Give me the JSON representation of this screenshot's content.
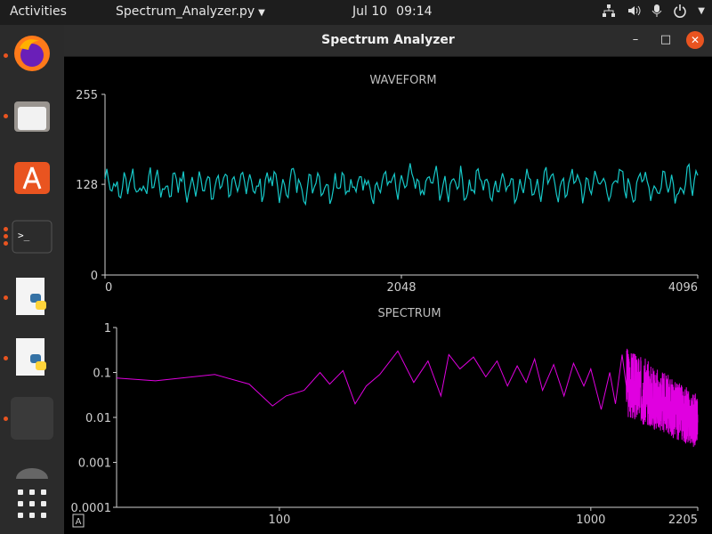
{
  "topbar": {
    "activities": "Activities",
    "app_menu": "Spectrum_Analyzer.py",
    "date": "Jul 10",
    "time": "09:14"
  },
  "dock": {
    "items": [
      "firefox-icon",
      "files-icon",
      "app-center-icon",
      "terminal-icon",
      "python-file-icon",
      "python-file-icon",
      "trash-icon",
      "show-apps-icon"
    ]
  },
  "window": {
    "title": "Spectrum Analyzer",
    "controls": {
      "minimize": "–",
      "maximize": "□",
      "close": "✕"
    },
    "corner_badge": "A"
  },
  "colors": {
    "waveform": "#16c8c8",
    "spectrum": "#e000e0",
    "accent": "#e95420"
  },
  "chart_data": [
    {
      "type": "line",
      "title": "WAVEFORM",
      "xlabel": "",
      "ylabel": "",
      "xlim": [
        0,
        4096
      ],
      "ylim": [
        0,
        255
      ],
      "x_ticks": [
        "0",
        "2048",
        "4096"
      ],
      "y_ticks": [
        "0",
        "128",
        "255"
      ],
      "series": [
        {
          "x": [
            0,
            4096
          ],
          "baseline": 128,
          "amplitude_range": [
            100,
            160
          ]
        }
      ]
    },
    {
      "type": "line",
      "title": "SPECTRUM",
      "xlabel": "",
      "ylabel": "",
      "x_scale": "log",
      "y_scale": "log",
      "xlim": [
        30,
        2205
      ],
      "ylim": [
        0.0001,
        1
      ],
      "x_ticks": [
        "100",
        "1000",
        "2205"
      ],
      "y_ticks": [
        "1",
        "0.1",
        "0.01",
        "0.001",
        "0.0001"
      ],
      "series": [
        {
          "x": [
            30,
            40,
            62,
            80,
            95,
            105,
            120,
            135,
            145,
            160,
            175,
            190,
            210,
            240,
            270,
            300,
            330,
            350,
            380,
            420,
            460,
            500,
            540,
            580,
            620,
            660,
            700,
            760,
            820,
            880,
            950,
            1000,
            1080,
            1150,
            1200,
            1260,
            1300
          ],
          "y": [
            0.075,
            0.065,
            0.09,
            0.055,
            0.018,
            0.03,
            0.04,
            0.1,
            0.055,
            0.11,
            0.02,
            0.05,
            0.09,
            0.3,
            0.06,
            0.18,
            0.03,
            0.25,
            0.12,
            0.22,
            0.08,
            0.18,
            0.05,
            0.14,
            0.06,
            0.2,
            0.04,
            0.15,
            0.03,
            0.16,
            0.05,
            0.12,
            0.015,
            0.1,
            0.02,
            0.25,
            0.05
          ]
        }
      ]
    }
  ]
}
